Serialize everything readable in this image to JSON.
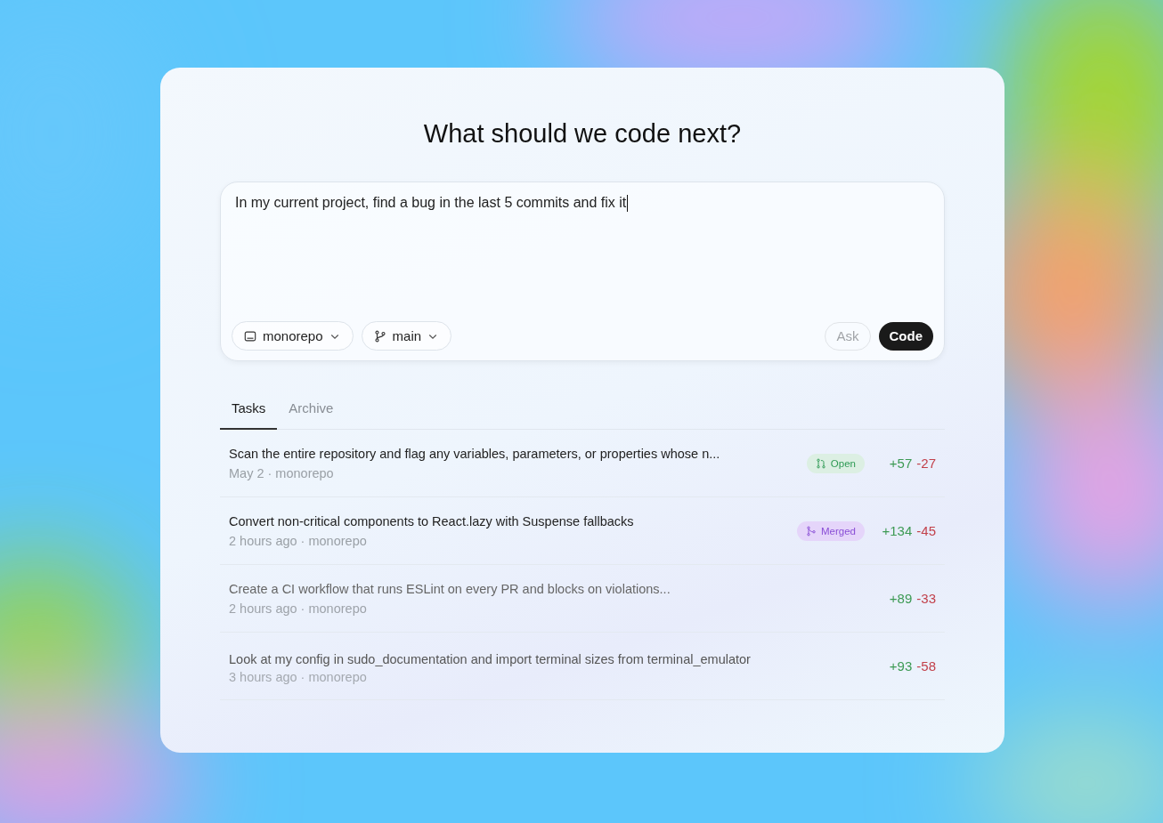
{
  "title": "What should we code next?",
  "prompt": {
    "value": "In my current project, find a bug in the last 5 commits and fix it"
  },
  "repo_selector": {
    "label": "monorepo"
  },
  "branch_selector": {
    "label": "main"
  },
  "buttons": [
    {
      "label": "Ask",
      "kind": "secondary"
    },
    {
      "label": "Code",
      "kind": "primary"
    }
  ],
  "tabs": [
    {
      "label": "Tasks",
      "selected": true
    },
    {
      "label": "Archive",
      "selected": false
    }
  ],
  "tasks": [
    {
      "title": "Scan the entire repository and flag any variables, parameters, or properties whose n...",
      "meta": "May 2 · monorepo",
      "status": "Open",
      "kind": "open",
      "added": "+57",
      "removed": "-27"
    },
    {
      "title": "Convert non-critical components to React.lazy with Suspense fallbacks",
      "meta": "2 hours ago · monorepo",
      "status": "Merged",
      "kind": "merged",
      "added": "+134",
      "removed": "-45"
    },
    {
      "title": "Create a CI workflow that runs ESLint on every PR and blocks on violations...",
      "meta": "2 hours ago · monorepo",
      "kind": "none",
      "added": "+89",
      "removed": "-33"
    },
    {
      "title": "Look at my config in sudo_documentation and import terminal sizes from terminal_emulator",
      "meta": "3 hours ago · monorepo",
      "kind": "none",
      "added": "+93",
      "removed": "-58"
    }
  ]
}
